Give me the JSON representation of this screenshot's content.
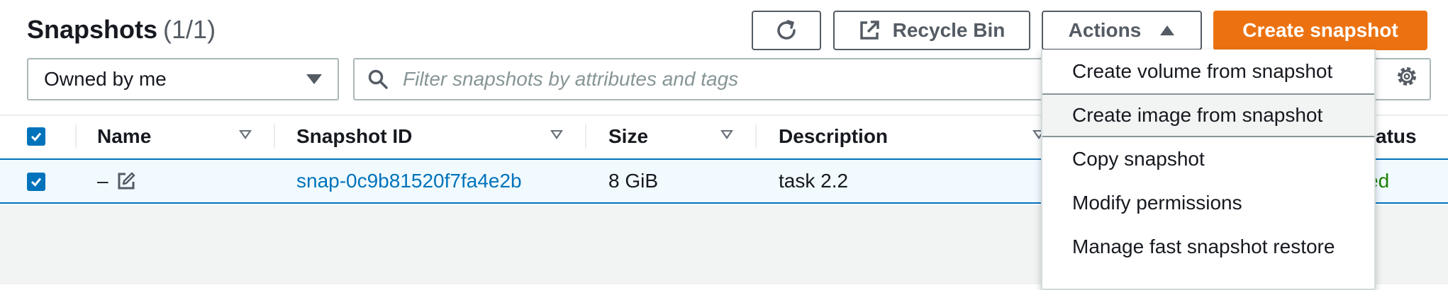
{
  "header": {
    "title": "Snapshots",
    "count": "(1/1)"
  },
  "toolbar": {
    "refresh_icon": "refresh-icon",
    "recycle_bin_label": "Recycle Bin",
    "actions_label": "Actions",
    "create_snapshot_label": "Create snapshot",
    "primary_color": "#ec7211"
  },
  "filter": {
    "owner_selected": "Owned by me",
    "search_placeholder": "Filter snapshots by attributes and tags"
  },
  "table": {
    "columns": [
      "Name",
      "Snapshot ID",
      "Size",
      "Description",
      "Status"
    ],
    "status_header_visible": "atus",
    "rows": [
      {
        "selected": true,
        "name": "–",
        "snapshot_id": "snap-0c9b81520f7fa4e2b",
        "size": "8 GiB",
        "description": "task 2.2",
        "status_visible": "ed"
      }
    ]
  },
  "actions_menu": {
    "items": [
      "Create volume from snapshot",
      "Create image from snapshot",
      "Copy snapshot",
      "Modify permissions",
      "Manage fast snapshot restore"
    ],
    "hovered_index": 1
  },
  "colors": {
    "link": "#0073bb",
    "status_ok": "#1d8102",
    "selected_row_bg": "#f1faff"
  }
}
